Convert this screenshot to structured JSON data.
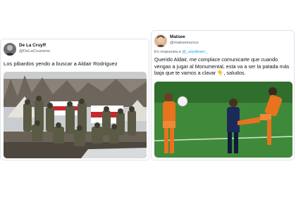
{
  "tweets": [
    {
      "user": {
        "display_name": "De La Cruyff",
        "handle": "@DeLaCruzismo"
      },
      "text": "Los pibardos yendo a buscar a Aldair Rodriguez",
      "media": {
        "icon": "photo-soldiers-with-flags"
      }
    },
    {
      "user": {
        "display_name": "Matsee",
        "handle": "@matseenunco"
      },
      "reply": {
        "prefix": "En respuesta a",
        "mention": "@_soydenier_"
      },
      "text": "Querido Aldair, me complace comunicarte que cuando vengas a jugar al Monumental, esta va a ser la patada más baja que te vamos a clavar",
      "emoji": "👇",
      "text_end": ", saludos.",
      "media": {
        "icon": "photo-football-kick"
      }
    }
  ],
  "colors": {
    "link": "#1d9bf0",
    "muted": "#536471",
    "border": "#dfe3e6",
    "pitch": "#3f8a3a",
    "orange": "#e8731e"
  }
}
